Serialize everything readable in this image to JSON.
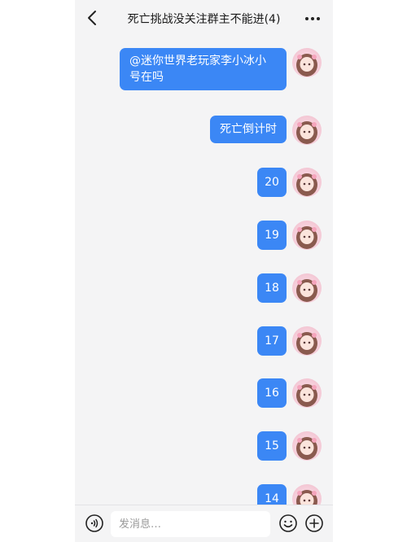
{
  "header": {
    "title": "死亡挑战没关注群主不能进(4)"
  },
  "messages": [
    {
      "text": "@迷你世界老玩家李小冰小号在吗"
    },
    {
      "text": "死亡倒计时"
    },
    {
      "text": "20"
    },
    {
      "text": "19"
    },
    {
      "text": "18"
    },
    {
      "text": "17"
    },
    {
      "text": "16"
    },
    {
      "text": "15"
    },
    {
      "text": "14"
    }
  ],
  "input": {
    "placeholder": "发消息…"
  },
  "colors": {
    "bubble": "#3b87f5",
    "background": "#f4f4f5"
  },
  "icons": {
    "back": "chevron-left-icon",
    "more": "more-dots-icon",
    "voice": "voice-icon",
    "emoji": "smiley-icon",
    "plus": "plus-circle-icon"
  }
}
